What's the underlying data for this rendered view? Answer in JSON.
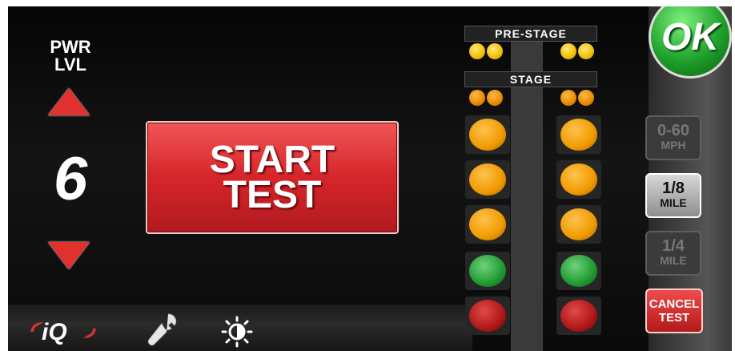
{
  "power_level": {
    "label": "PWR\nLVL",
    "value": "6",
    "increase_icon": "triangle-up-icon",
    "decrease_icon": "triangle-down-icon"
  },
  "start_button": {
    "label": "START\nTEST"
  },
  "ok_button": {
    "label": "OK"
  },
  "tree": {
    "prestage_label": "PRE-STAGE",
    "stage_label": "STAGE",
    "lights": [
      "amber",
      "amber",
      "amber",
      "green",
      "red"
    ]
  },
  "modes": [
    {
      "main": "0-60",
      "sub": "MPH",
      "state": "disabled"
    },
    {
      "main": "1/8",
      "sub": "MILE",
      "state": "active"
    },
    {
      "main": "1/4",
      "sub": "MILE",
      "state": "disabled"
    }
  ],
  "cancel_button": {
    "label": "CANCEL\nTEST"
  },
  "bottom_bar": {
    "logo_text": "iQ",
    "settings_icon": "wrench-icon",
    "brightness_icon": "brightness-icon"
  },
  "colors": {
    "red_button": "#d6252a",
    "ok_green": "#1fa12a",
    "amber": "#f09a00",
    "green_light": "#1f9b32",
    "red_light": "#b01717"
  }
}
